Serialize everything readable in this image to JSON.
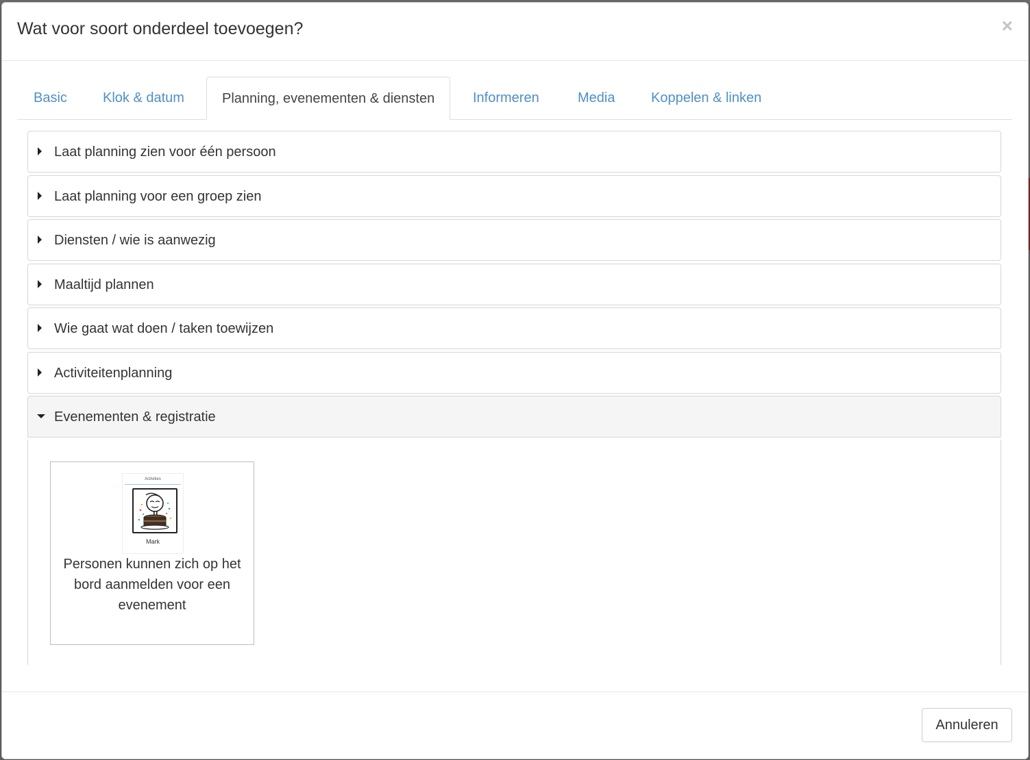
{
  "dialog": {
    "title": "Wat voor soort onderdeel toevoegen?",
    "close_label": "×"
  },
  "tabs": [
    {
      "label": "Basic",
      "active": false
    },
    {
      "label": "Klok & datum",
      "active": false
    },
    {
      "label": "Planning, evenementen & diensten",
      "active": true
    },
    {
      "label": "Informeren",
      "active": false
    },
    {
      "label": "Media",
      "active": false
    },
    {
      "label": "Koppelen & linken",
      "active": false
    }
  ],
  "accordion": [
    {
      "label": "Laat planning zien voor één persoon",
      "expanded": false
    },
    {
      "label": "Laat planning voor een groep zien",
      "expanded": false
    },
    {
      "label": "Diensten / wie is aanwezig",
      "expanded": false
    },
    {
      "label": "Maaltijd plannen",
      "expanded": false
    },
    {
      "label": "Wie gaat wat doen / taken toewijzen",
      "expanded": false
    },
    {
      "label": "Activiteitenplanning",
      "expanded": false
    },
    {
      "label": "Evenementen & registratie",
      "expanded": true
    }
  ],
  "event_card": {
    "thumb_title": "Activities",
    "thumb_name": "Mark",
    "description": "Personen kunnen zich op het bord aanmelden voor een evenement"
  },
  "footer": {
    "cancel_label": "Annuleren"
  },
  "colors": {
    "tab_link": "#4f8fc6",
    "text": "#333333",
    "open_header_bg": "#f5f5f5"
  }
}
